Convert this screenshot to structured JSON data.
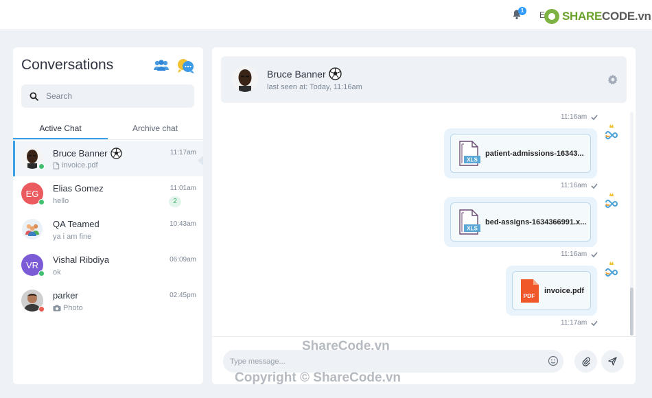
{
  "topbar": {
    "notification_count": "1",
    "user_initial": "E",
    "brand_part1": "SHARE",
    "brand_part2": "CODE.vn"
  },
  "sidebar": {
    "title": "Conversations",
    "search_placeholder": "Search",
    "tabs": [
      {
        "label": "Active Chat"
      },
      {
        "label": "Archive chat"
      }
    ],
    "chats": [
      {
        "name": "Bruce Banner",
        "subtitle": "invoice.pdf",
        "time": "11:17am",
        "initials": "",
        "status": "online"
      },
      {
        "name": "Elias Gomez",
        "subtitle": "hello",
        "time": "11:01am",
        "initials": "EG",
        "unread": "2",
        "status": "online"
      },
      {
        "name": "QA Teamed",
        "subtitle": "ya i am fine",
        "time": "10:43am",
        "initials": ""
      },
      {
        "name": "Vishal Ribdiya",
        "subtitle": "ok",
        "time": "06:09am",
        "initials": "VR",
        "status": "online"
      },
      {
        "name": "parker",
        "subtitle": "Photo",
        "time": "02:45pm",
        "initials": "",
        "status": "busy"
      }
    ]
  },
  "chat": {
    "name": "Bruce Banner",
    "last_seen": "last seen at: Today, 11:16am",
    "messages": [
      {
        "time_above": "11:16am",
        "file_type": "XLS",
        "file_name": "patient-admissions-16343...",
        "time_below": "11:16am"
      },
      {
        "file_type": "XLS",
        "file_name": "bed-assigns-1634366991.x...",
        "time_below": "11:16am"
      },
      {
        "file_type": "PDF",
        "file_name": "invoice.pdf",
        "time_below": "11:17am"
      }
    ],
    "input_placeholder": "Type message..."
  },
  "watermark": {
    "line1": "ShareCode.vn",
    "line2": "Copyright © ShareCode.vn"
  },
  "colors": {
    "accent": "#3aa0e8",
    "online": "#3fbf6f",
    "busy": "#e85a4f",
    "elias_avatar": "#eb5a5e",
    "vishal_avatar": "#7b5cd6",
    "xls": "#5aa7d6",
    "pdf": "#f0582a"
  }
}
